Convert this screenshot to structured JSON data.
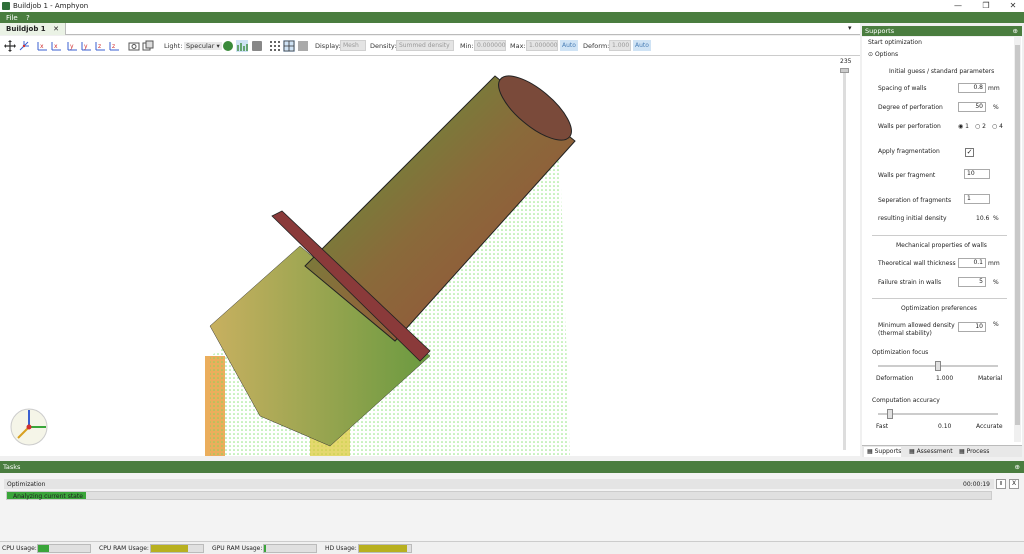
{
  "window": {
    "title": "Buildjob 1 - Amphyon",
    "minimize": "—",
    "maximize": "❐",
    "close": "✕"
  },
  "menu": {
    "file": "File",
    "help": "?"
  },
  "doc_tab": {
    "label": "Buildjob 1",
    "close": "✕"
  },
  "toolbar": {
    "light_label": "Light:",
    "light_value": "Specular",
    "display_label": "Display:",
    "display_value": "Mesh",
    "density_label": "Density:",
    "density_value": "Summed density",
    "min_label": "Min:",
    "min_value": "0.000000",
    "max_label": "Max:",
    "max_value": "1.000000",
    "max_auto": "Auto",
    "deform_label": "Deform:",
    "deform_value": "1.000",
    "deform_auto": "Auto"
  },
  "viewport": {
    "slider_value": "235"
  },
  "supports_panel": {
    "title": "Supports",
    "start": "Start optimization",
    "options": "Options",
    "section_initial": "Initial guess / standard parameters",
    "spacing_label": "Spacing of walls",
    "spacing_value": "0.8",
    "spacing_unit": "mm",
    "perforation_label": "Degree of perforation",
    "perforation_value": "50",
    "perforation_unit": "%",
    "walls_perf_label": "Walls per perforation",
    "walls_perf_opt1": "1",
    "walls_perf_opt2": "2",
    "walls_perf_opt3": "4",
    "frag_label": "Apply fragmentation",
    "frag_checked": "✓",
    "walls_frag_label": "Walls per fragment",
    "walls_frag_value": "10",
    "sep_label": "Seperation of fragments",
    "sep_value": "1",
    "density_label": "resulting initial density",
    "density_value": "10.6",
    "density_unit": "%",
    "section_mech": "Mechanical properties of walls",
    "thick_label": "Theoretical wall thickness",
    "thick_value": "0.1",
    "thick_unit": "mm",
    "strain_label": "Failure strain in walls",
    "strain_value": "5",
    "strain_unit": "%",
    "section_opt": "Optimization preferences",
    "min_density_label": "Minimum allowed density",
    "min_density_label2": "(thermal stability)",
    "min_density_value": "10",
    "min_density_unit": "%",
    "focus_label": "Optimization focus",
    "focus_left": "Deformation",
    "focus_value": "1.000",
    "focus_right": "Material",
    "accuracy_label": "Computation accuracy",
    "accuracy_left": "Fast",
    "accuracy_value": "0.10",
    "accuracy_right": "Accurate"
  },
  "side_tabs": {
    "supports": "Supports",
    "assessment": "Assessment",
    "process": "Process"
  },
  "tasks": {
    "title": "Tasks",
    "job": "Optimization",
    "time": "00:00:19",
    "pause": "II",
    "stop": "X",
    "status": "Analyzing current state",
    "progress": 0.08
  },
  "status": {
    "cpu": "CPU Usage:",
    "cpu_level": 0.22,
    "cpu_ram": "CPU RAM Usage:",
    "cpu_ram_level": 0.72,
    "gpu_ram": "GPU RAM Usage:",
    "gpu_ram_level": 0.03,
    "hd": "HD Usage:",
    "hd_level": 0.92
  },
  "colors": {
    "accent": "#4a7d3f",
    "green_bar": "#3aa53a",
    "olive_bar": "#b8b020"
  }
}
